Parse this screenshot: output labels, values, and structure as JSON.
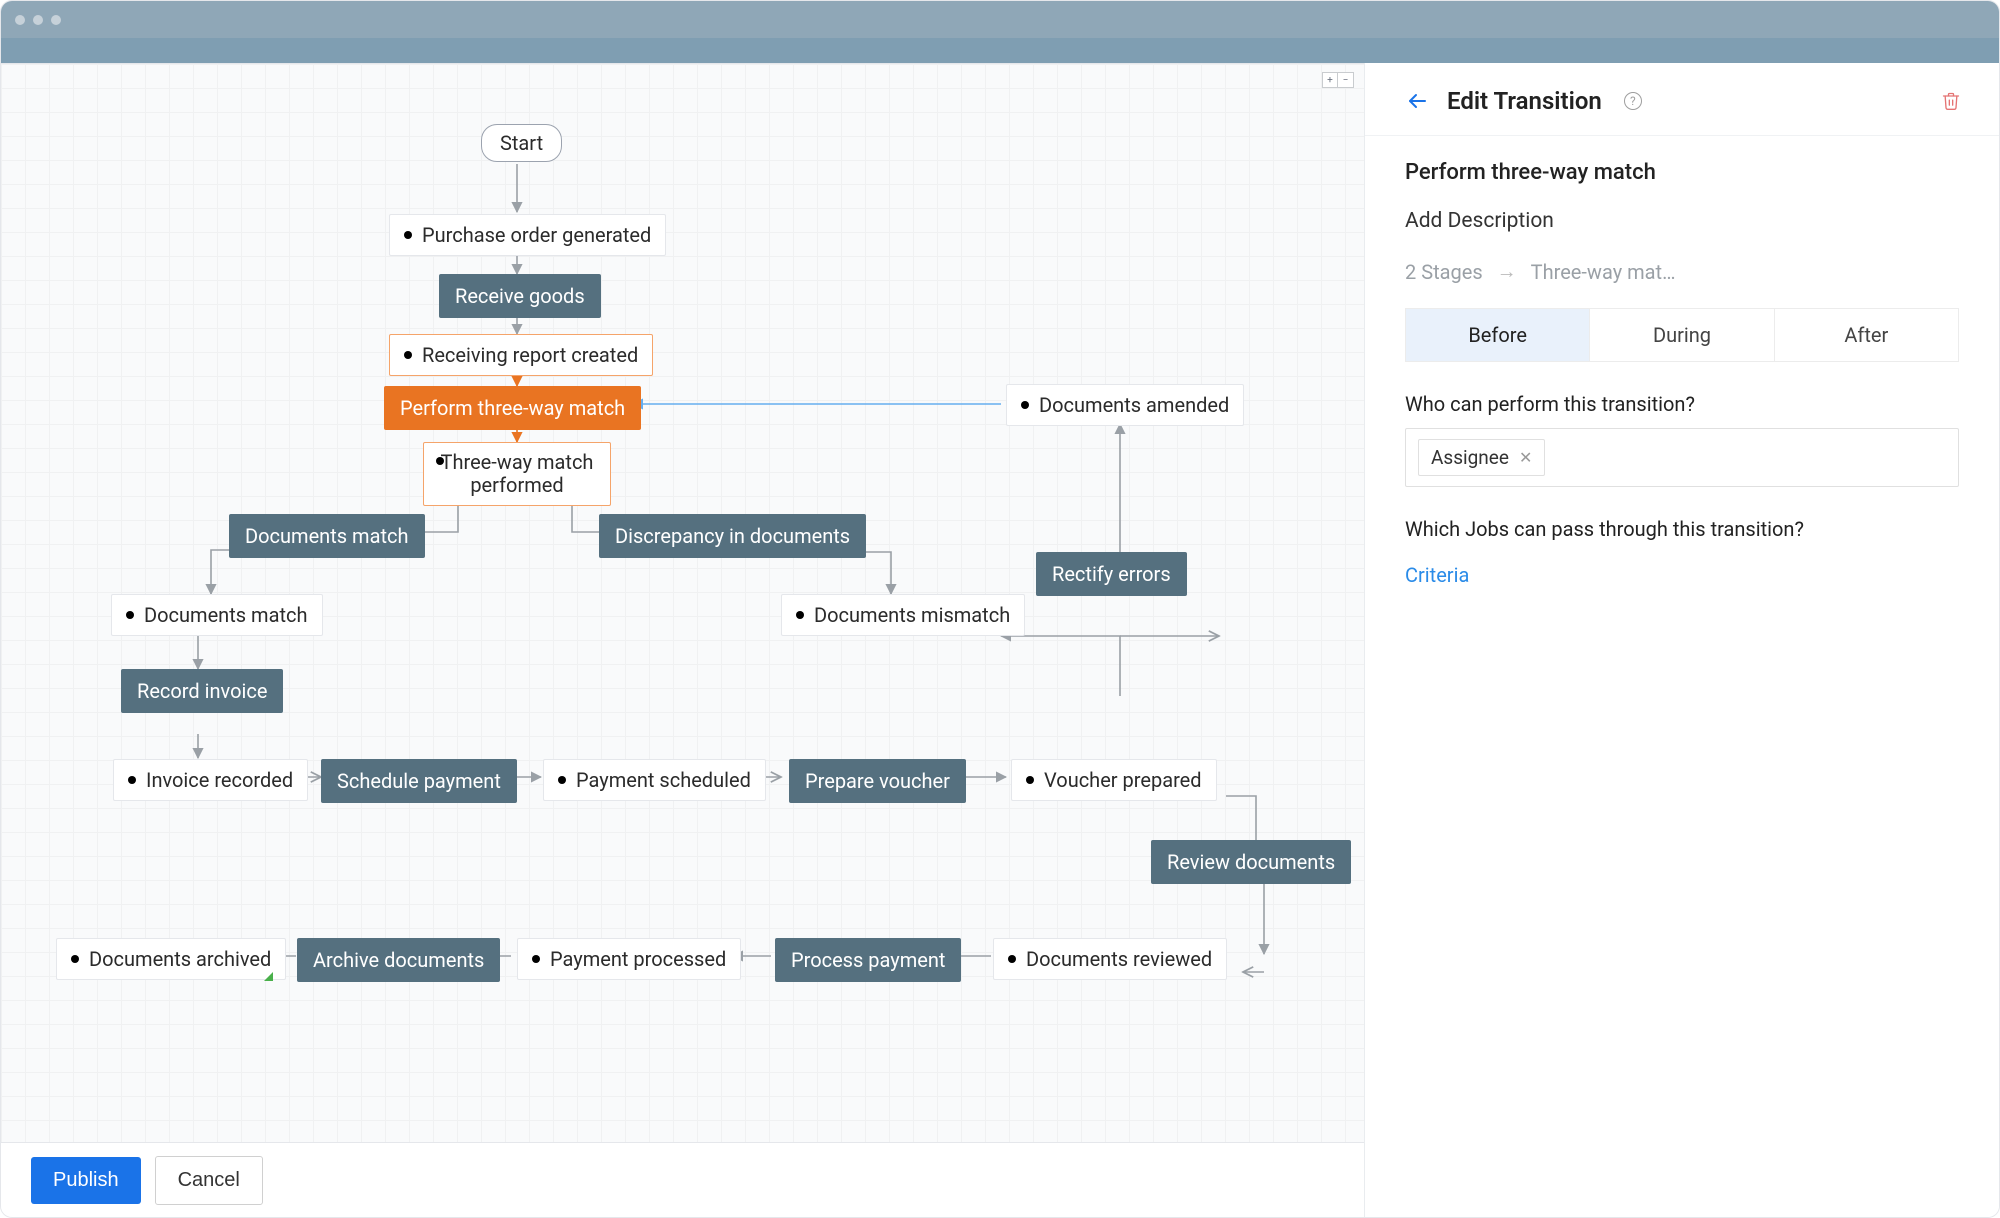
{
  "window": {
    "title": ""
  },
  "diagram": {
    "start_label": "Start",
    "states": {
      "s1": "Purchase order generated",
      "s2": "Receiving report created",
      "s3_line1": "Three-way match",
      "s3_line2": "performed",
      "s4": "Documents match",
      "s5": "Invoice recorded",
      "s6": "Payment scheduled",
      "s7": "Voucher prepared",
      "s8": "Documents reviewed",
      "s9": "Payment processed",
      "s10": "Documents archived",
      "s11": "Documents mismatch",
      "s12": "Documents amended"
    },
    "transitions": {
      "t1": "Receive goods",
      "t2": "Perform three-way match",
      "t3": "Documents match",
      "t4": "Discrepancy in documents",
      "t5": "Record invoice",
      "t6": "Schedule payment",
      "t7": "Prepare voucher",
      "t8": "Review documents",
      "t9": "Process payment",
      "t10": "Archive documents",
      "t11": "Rectify errors"
    },
    "zoom": {
      "in": "⊞",
      "out": "⊟"
    }
  },
  "footer": {
    "publish": "Publish",
    "cancel": "Cancel"
  },
  "panel": {
    "title": "Edit Transition",
    "subject": "Perform three-way match",
    "add_description": "Add Description",
    "stages_left": "2 Stages",
    "stages_right": "Three-way mat…",
    "tabs": {
      "before": "Before",
      "during": "During",
      "after": "After"
    },
    "q1": "Who can perform this transition?",
    "chip1": "Assignee",
    "q2": "Which Jobs can pass through this transition?",
    "criteria": "Criteria"
  }
}
